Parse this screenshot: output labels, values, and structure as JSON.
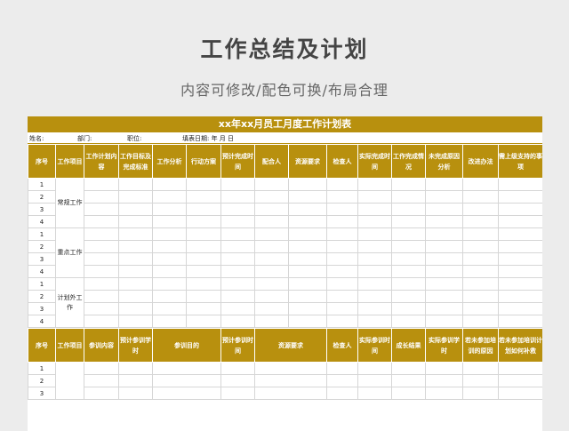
{
  "page": {
    "title": "工作总结及计划",
    "subtitle": "内容可修改/配色可换/布局合理"
  },
  "sheet": {
    "title": "xx年xx月员工月度工作计划表",
    "info": {
      "name": "姓名:",
      "dept": "部门:",
      "position": "职位:",
      "date": "填表日期:    年   月   日"
    },
    "header1": [
      "序号",
      "工作项目",
      "工作计划内容",
      "工作目标及完成标准",
      "工作分析",
      "行动方案",
      "预计完成时间",
      "配合人",
      "资源要求",
      "检查人",
      "实际完成时间",
      "工作完成情况",
      "未完成原因分析",
      "改进办法",
      "需上级支持的事项"
    ],
    "groups": [
      {
        "category": "常规工作",
        "rows": [
          "1",
          "2",
          "3",
          "4"
        ]
      },
      {
        "category": "重点工作",
        "rows": [
          "1",
          "2",
          "3",
          "4"
        ]
      },
      {
        "category": "计划外工作",
        "rows": [
          "1",
          "2",
          "3",
          "4"
        ]
      }
    ],
    "header2": [
      "序号",
      "工作项目",
      "参训内容",
      "预计参训学时",
      "参训目的",
      "预计参训时间",
      "资源要求",
      "检查人",
      "实际参训时间",
      "成长结果",
      "实际参训学时",
      "若未参加培训的原因",
      "若未参加培训计划如何补救"
    ],
    "training_rows": [
      "1",
      "2",
      "3"
    ]
  },
  "colors": {
    "accent": "#b8900e",
    "background": "#ececec"
  }
}
